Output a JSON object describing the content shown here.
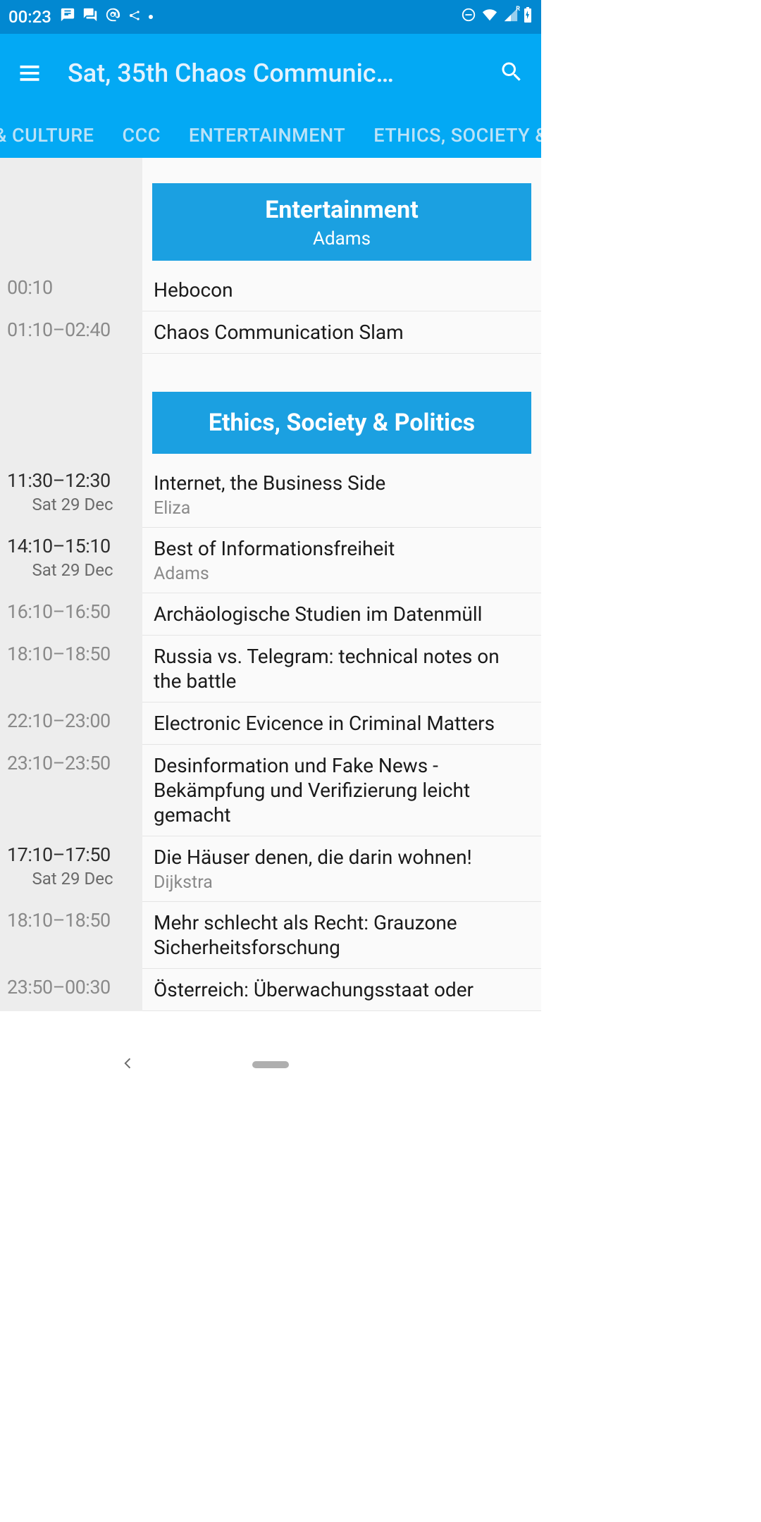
{
  "statusbar": {
    "time": "00:23"
  },
  "appbar": {
    "title": "Sat, 35th Chaos Communic…"
  },
  "tabs": [
    "& CULTURE",
    "CCC",
    "ENTERTAINMENT",
    "ETHICS, SOCIETY &"
  ],
  "sections": [
    {
      "title": "Entertainment",
      "room": "Adams",
      "events": [
        {
          "time": "00:10",
          "time_gray": true,
          "date": "",
          "title": "Hebocon",
          "room": ""
        },
        {
          "time": "01:10–02:40",
          "time_gray": true,
          "date": "",
          "title": "Chaos Communication Slam",
          "room": ""
        }
      ]
    },
    {
      "title": "Ethics, Society & Politics",
      "room": "",
      "events": [
        {
          "time": "11:30–12:30",
          "time_gray": false,
          "date": "Sat 29 Dec",
          "title": "Internet, the Business Side",
          "room": "Eliza"
        },
        {
          "time": "14:10–15:10",
          "time_gray": false,
          "date": "Sat 29 Dec",
          "title": "Best of Informationsfreiheit",
          "room": "Adams"
        },
        {
          "time": "16:10–16:50",
          "time_gray": true,
          "date": "",
          "title": "Archäologische Studien im Datenmüll",
          "room": ""
        },
        {
          "time": "18:10–18:50",
          "time_gray": true,
          "date": "",
          "title": "Russia vs. Telegram: technical notes on the battle",
          "room": ""
        },
        {
          "time": "22:10–23:00",
          "time_gray": true,
          "date": "",
          "title": "Electronic Evicence in Criminal Matters",
          "room": ""
        },
        {
          "time": "23:10–23:50",
          "time_gray": true,
          "date": "",
          "title": "Desinformation und Fake News - Bekämpfung und Verifizierung leicht gemacht",
          "room": ""
        },
        {
          "time": "17:10–17:50",
          "time_gray": false,
          "date": "Sat 29 Dec",
          "title": "Die Häuser denen, die darin wohnen!",
          "room": "Dijkstra"
        },
        {
          "time": "18:10–18:50",
          "time_gray": true,
          "date": "",
          "title": "Mehr schlecht als Recht: Grauzone Sicherheitsforschung",
          "room": ""
        },
        {
          "time": "23:50–00:30",
          "time_gray": true,
          "date": "",
          "title": "Österreich: Überwachungsstaat oder",
          "room": ""
        }
      ]
    }
  ]
}
